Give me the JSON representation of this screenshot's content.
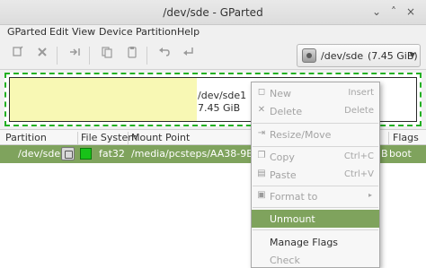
{
  "window": {
    "title": "/dev/sde - GParted",
    "minimize_glyph": "⌄",
    "maximize_glyph": "˄",
    "close_glyph": "×"
  },
  "menubar": {
    "items": [
      "GParted",
      "Edit",
      "View",
      "Device",
      "Partition",
      "Help"
    ]
  },
  "toolbar": {
    "icons": [
      "new-icon",
      "delete-icon",
      "resize-move-icon",
      "copy-icon",
      "paste-icon",
      "undo-icon",
      "apply-icon"
    ],
    "device": {
      "name": "/dev/sde",
      "size": "(7.45 GiB)"
    }
  },
  "disk_visual": {
    "partition": "/dev/sde1",
    "size": "7.45 GiB",
    "used_fraction": 0.46,
    "used_color": "#f8f8b4",
    "border_color": "#22b022"
  },
  "table": {
    "columns": [
      "Partition",
      "File System",
      "Mount Point",
      "Flags"
    ],
    "rows": [
      {
        "partition": "/dev/sde1",
        "filesystem": "fat32",
        "mount_point": "/media/pcsteps/AA38-9E1F",
        "flags_partial": "B",
        "flags": "boot"
      }
    ],
    "fs_color": "#18c218",
    "selected_color": "#7fa35d"
  },
  "context_menu": {
    "items": [
      {
        "label": "New",
        "accel": "Insert",
        "icon": "new-icon",
        "enabled": false
      },
      {
        "label": "Delete",
        "accel": "Delete",
        "icon": "delete-icon",
        "enabled": false
      },
      {
        "label": "Resize/Move",
        "accel": "",
        "icon": "resize-move-icon",
        "enabled": false
      },
      {
        "label": "Copy",
        "accel": "Ctrl+C",
        "icon": "copy-icon",
        "enabled": false
      },
      {
        "label": "Paste",
        "accel": "Ctrl+V",
        "icon": "paste-icon",
        "enabled": false
      },
      {
        "label": "Format to",
        "accel": "▸",
        "icon": "format-icon",
        "enabled": false
      },
      {
        "label": "Unmount",
        "accel": "",
        "icon": "",
        "enabled": true,
        "selected": true
      },
      {
        "label": "Manage Flags",
        "accel": "",
        "icon": "",
        "enabled": true
      },
      {
        "label": "Check",
        "accel": "",
        "icon": "",
        "enabled": false
      }
    ]
  }
}
